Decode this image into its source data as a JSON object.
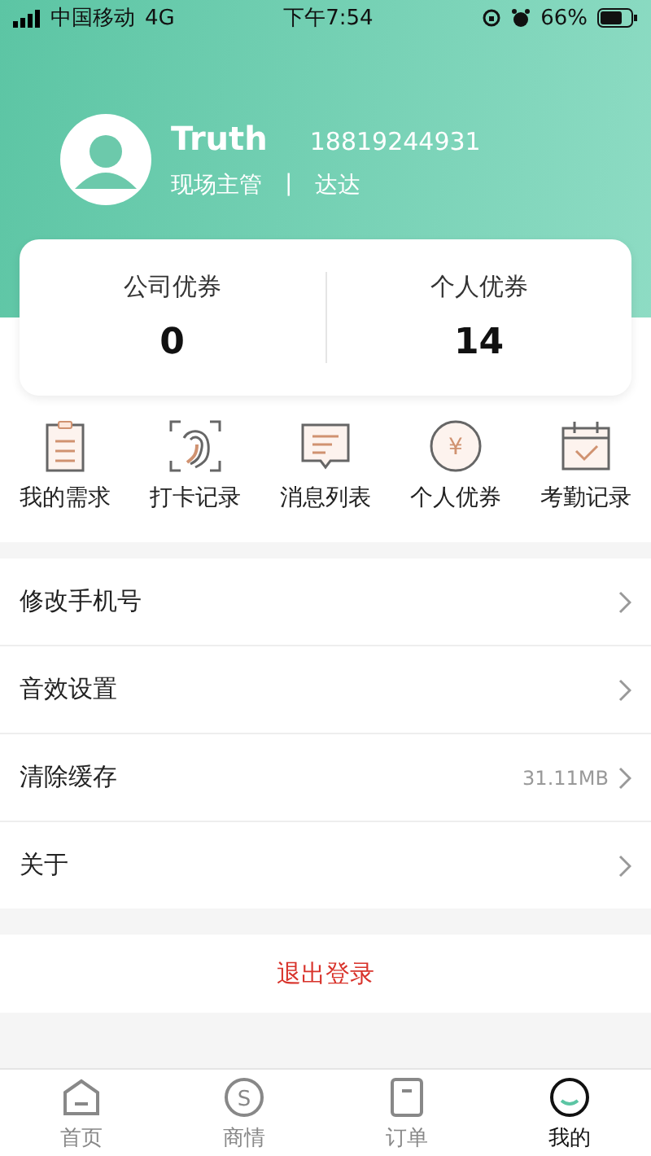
{
  "status_bar": {
    "carrier": "中国移动",
    "network": "4G",
    "time": "下午7:54",
    "battery": "66%"
  },
  "profile": {
    "name": "Truth",
    "phone": "18819244931",
    "role": "现场主管",
    "separator": "|",
    "team": "达达"
  },
  "coupons": [
    {
      "label": "公司优券",
      "count": "0"
    },
    {
      "label": "个人优券",
      "count": "14"
    }
  ],
  "shortcuts": [
    {
      "kind": "clipboard",
      "label": "我的需求"
    },
    {
      "kind": "fingerprint",
      "label": "打卡记录"
    },
    {
      "kind": "message",
      "label": "消息列表"
    },
    {
      "kind": "coin",
      "label": "个人优券",
      "glyph": "¥"
    },
    {
      "kind": "calendar",
      "label": "考勤记录"
    }
  ],
  "settings": [
    {
      "label": "修改手机号"
    },
    {
      "label": "音效设置"
    },
    {
      "label": "清除缓存",
      "value": "31.11MB"
    },
    {
      "label": "关于"
    }
  ],
  "logout": "退出登录",
  "tabs": [
    {
      "kind": "home",
      "label": "首页",
      "selected": false
    },
    {
      "kind": "coin",
      "label": "商情",
      "glyph": "S",
      "selected": false
    },
    {
      "kind": "order",
      "label": "订单",
      "selected": false
    },
    {
      "kind": "me",
      "label": "我的",
      "selected": true
    }
  ]
}
